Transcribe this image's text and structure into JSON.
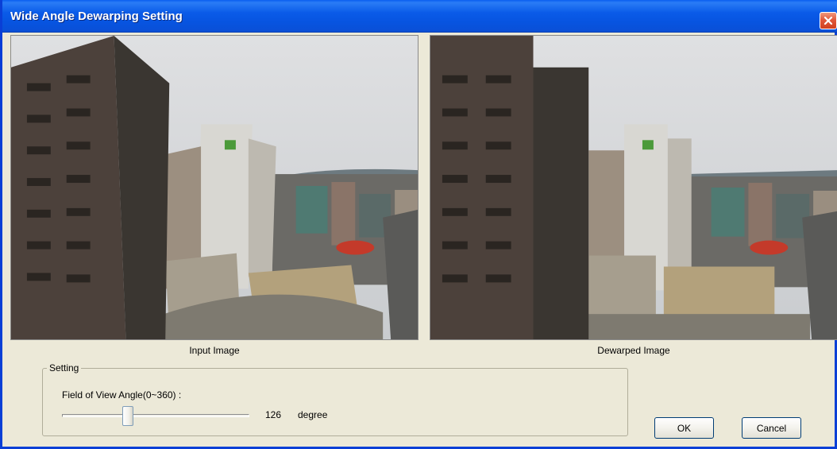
{
  "window": {
    "title": "Wide Angle Dewarping Setting"
  },
  "images": {
    "input_caption": "Input Image",
    "dewarped_caption": "Dewarped Image"
  },
  "setting": {
    "group_label": "Setting",
    "fov_label": "Field of View Angle(0~360) :",
    "fov_value": "126",
    "fov_unit": "degree",
    "fov_min": 0,
    "fov_max": 360,
    "fov_fraction": 0.35
  },
  "buttons": {
    "ok_label": "OK",
    "cancel_label": "Cancel"
  },
  "colors": {
    "titlebar": "#0a5be8",
    "close_button": "#e2583a",
    "dialog_bg": "#ece9d8"
  }
}
